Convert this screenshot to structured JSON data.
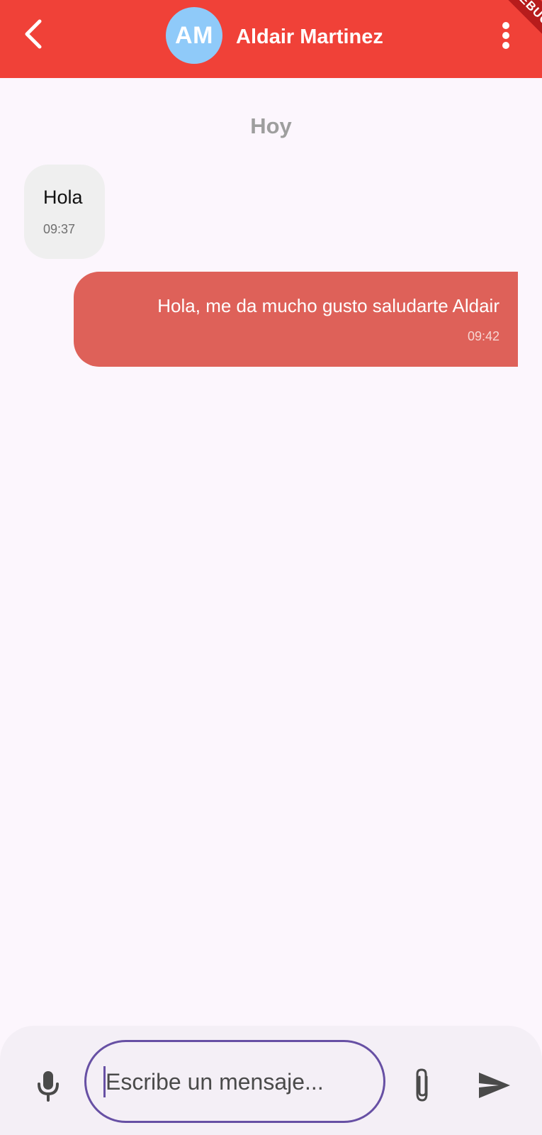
{
  "app_bar": {
    "back_icon": "chevron-left-icon",
    "avatar_initials": "AM",
    "contact_name": "Aldair Martinez",
    "menu_icon": "more-vert-icon",
    "debug_banner": "DEBUG",
    "colors": {
      "background": "#f04138",
      "avatar": "#8fcaf9"
    }
  },
  "chat": {
    "day_label": "Hoy",
    "messages": [
      {
        "direction": "incoming",
        "text": "Hola",
        "time": "09:37",
        "bubble_color": "#efefef"
      },
      {
        "direction": "outgoing",
        "text": "Hola, me da mucho gusto saludarte Aldair",
        "time": "09:42",
        "bubble_color": "#de6159"
      }
    ]
  },
  "composer": {
    "mic_icon": "microphone-icon",
    "input_value": "",
    "input_placeholder": "Escribe un mensaje...",
    "attach_icon": "paperclip-icon",
    "send_icon": "send-icon",
    "accent_color": "#6750a4"
  }
}
